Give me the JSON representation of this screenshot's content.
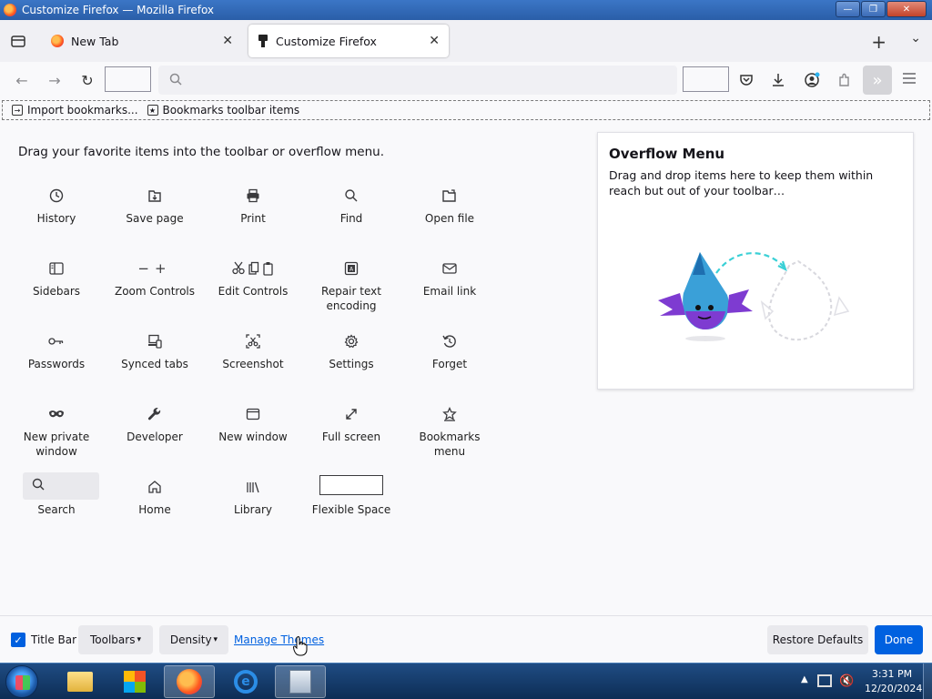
{
  "window": {
    "title": "Customize Firefox — Mozilla Firefox",
    "minimize": "—",
    "maximize": "❐",
    "close": "✕"
  },
  "tabs": [
    {
      "label": "New Tab",
      "icon": "firefox-icon",
      "active": false
    },
    {
      "label": "Customize Firefox",
      "icon": "paintbrush-icon",
      "active": true
    }
  ],
  "tab_controls": {
    "new_tab": "+",
    "list_all": "⌄",
    "close": "✕"
  },
  "bookmarks_toolbar": [
    {
      "label": "Import bookmarks...",
      "icon": "import-icon"
    },
    {
      "label": "Bookmarks toolbar items",
      "icon": "star-icon"
    }
  ],
  "palette": {
    "heading": "Drag your favorite items into the toolbar or overflow menu.",
    "items": [
      {
        "label": "History",
        "icon": "clock-icon"
      },
      {
        "label": "Save page",
        "icon": "save-page-icon"
      },
      {
        "label": "Print",
        "icon": "printer-icon"
      },
      {
        "label": "Find",
        "icon": "magnifier-icon"
      },
      {
        "label": "Open file",
        "icon": "folder-icon"
      },
      {
        "label": "Sidebars",
        "icon": "sidebar-icon"
      },
      {
        "label": "Zoom Controls",
        "icon": "zoom-icon"
      },
      {
        "label": "Edit Controls",
        "icon": "cut-copy-paste-icon"
      },
      {
        "label": "Repair text encoding",
        "icon": "text-encoding-icon"
      },
      {
        "label": "Email link",
        "icon": "envelope-icon"
      },
      {
        "label": "Passwords",
        "icon": "key-icon"
      },
      {
        "label": "Synced tabs",
        "icon": "synced-tabs-icon"
      },
      {
        "label": "Screenshot",
        "icon": "screenshot-icon"
      },
      {
        "label": "Settings",
        "icon": "gear-icon"
      },
      {
        "label": "Forget",
        "icon": "forget-icon"
      },
      {
        "label": "New private window",
        "icon": "private-mask-icon"
      },
      {
        "label": "Developer",
        "icon": "wrench-icon"
      },
      {
        "label": "New window",
        "icon": "window-icon"
      },
      {
        "label": "Full screen",
        "icon": "fullscreen-icon"
      },
      {
        "label": "Bookmarks menu",
        "icon": "bookmark-star-icon"
      },
      {
        "label": "Search",
        "icon": "search-icon"
      },
      {
        "label": "Home",
        "icon": "home-icon"
      },
      {
        "label": "Library",
        "icon": "library-icon"
      },
      {
        "label": "Flexible Space",
        "icon": "flexible-space-icon"
      }
    ]
  },
  "overflow_panel": {
    "title": "Overflow Menu",
    "description": "Drag and drop items here to keep them within reach but out of your toolbar…"
  },
  "footer": {
    "title_bar_label": "Title Bar",
    "title_bar_checked": true,
    "toolbars_label": "Toolbars",
    "density_label": "Density",
    "manage_themes_label": "Manage Themes",
    "restore_defaults_label": "Restore Defaults",
    "done_label": "Done"
  },
  "taskbar": {
    "time": "3:31 PM",
    "date": "12/20/2024"
  },
  "colors": {
    "accent": "#0061e0",
    "link": "#0060df",
    "titlebar": "#3b76c6"
  }
}
